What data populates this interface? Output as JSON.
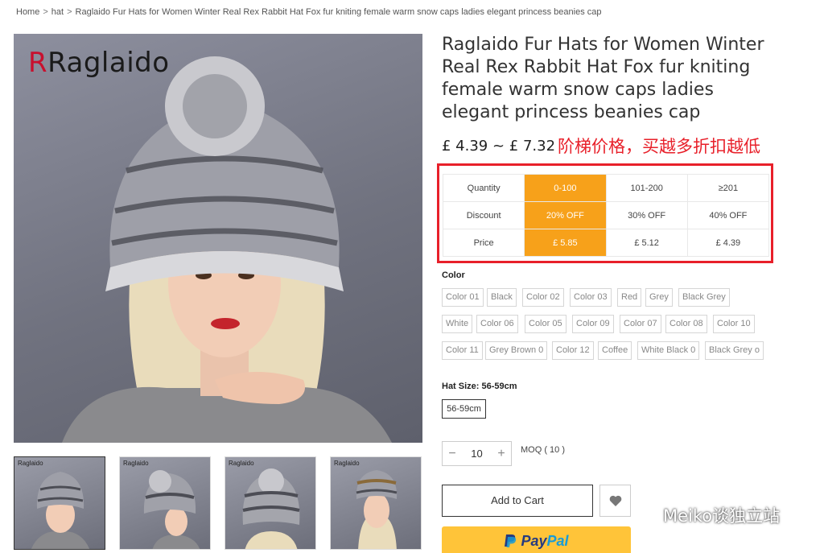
{
  "breadcrumb": {
    "home": "Home",
    "sep": ">",
    "category": "hat",
    "current": "Raglaido Fur Hats for Women Winter Real Rex Rabbit Hat Fox fur kniting female warm snow caps ladies elegant princess beanies cap"
  },
  "product": {
    "brand": "Raglaido",
    "title": "Raglaido Fur Hats for Women Winter Real Rex Rabbit Hat Fox fur kniting female warm snow caps ladies elegant princess beanies cap",
    "price_range": "£ 4.39 ~ £ 7.32",
    "annotation": "阶梯价格，买越多折扣越低",
    "thumb_brand": "Raglaido"
  },
  "tiers": {
    "rows": [
      {
        "label": "Quantity",
        "cells": [
          "0-100",
          "101-200",
          "≥201"
        ]
      },
      {
        "label": "Discount",
        "cells": [
          "20% OFF",
          "30% OFF",
          "40% OFF"
        ]
      },
      {
        "label": "Price",
        "cells": [
          "£ 5.85",
          "£ 5.12",
          "£ 4.39"
        ]
      }
    ]
  },
  "colors": {
    "label": "Color",
    "options": [
      "Color 01",
      "Black",
      "Color 02",
      "Color 03",
      "Red",
      "Grey",
      "Black Grey",
      "White",
      "Color 06",
      "Color 05",
      "Color 09",
      "Color 07",
      "Color 08",
      "Color 10",
      "Color 11",
      "Grey Brown 0",
      "Color 12",
      "Coffee",
      "White Black 0",
      "Black Grey o"
    ]
  },
  "size": {
    "label": "Hat Size: 56-59cm",
    "option": "56-59cm"
  },
  "quantity": {
    "minus": "−",
    "value": "10",
    "plus": "+",
    "moq": "MOQ ( 10 )"
  },
  "actions": {
    "add_to_cart": "Add to Cart",
    "paypal_a": "Pay",
    "paypal_b": "Pal"
  },
  "watermark": {
    "text": "Meiko谈独立站"
  },
  "theme": {
    "highlight": "#f7a11a",
    "annotation_red": "#e8202a",
    "paypal_yellow": "#ffc439"
  }
}
